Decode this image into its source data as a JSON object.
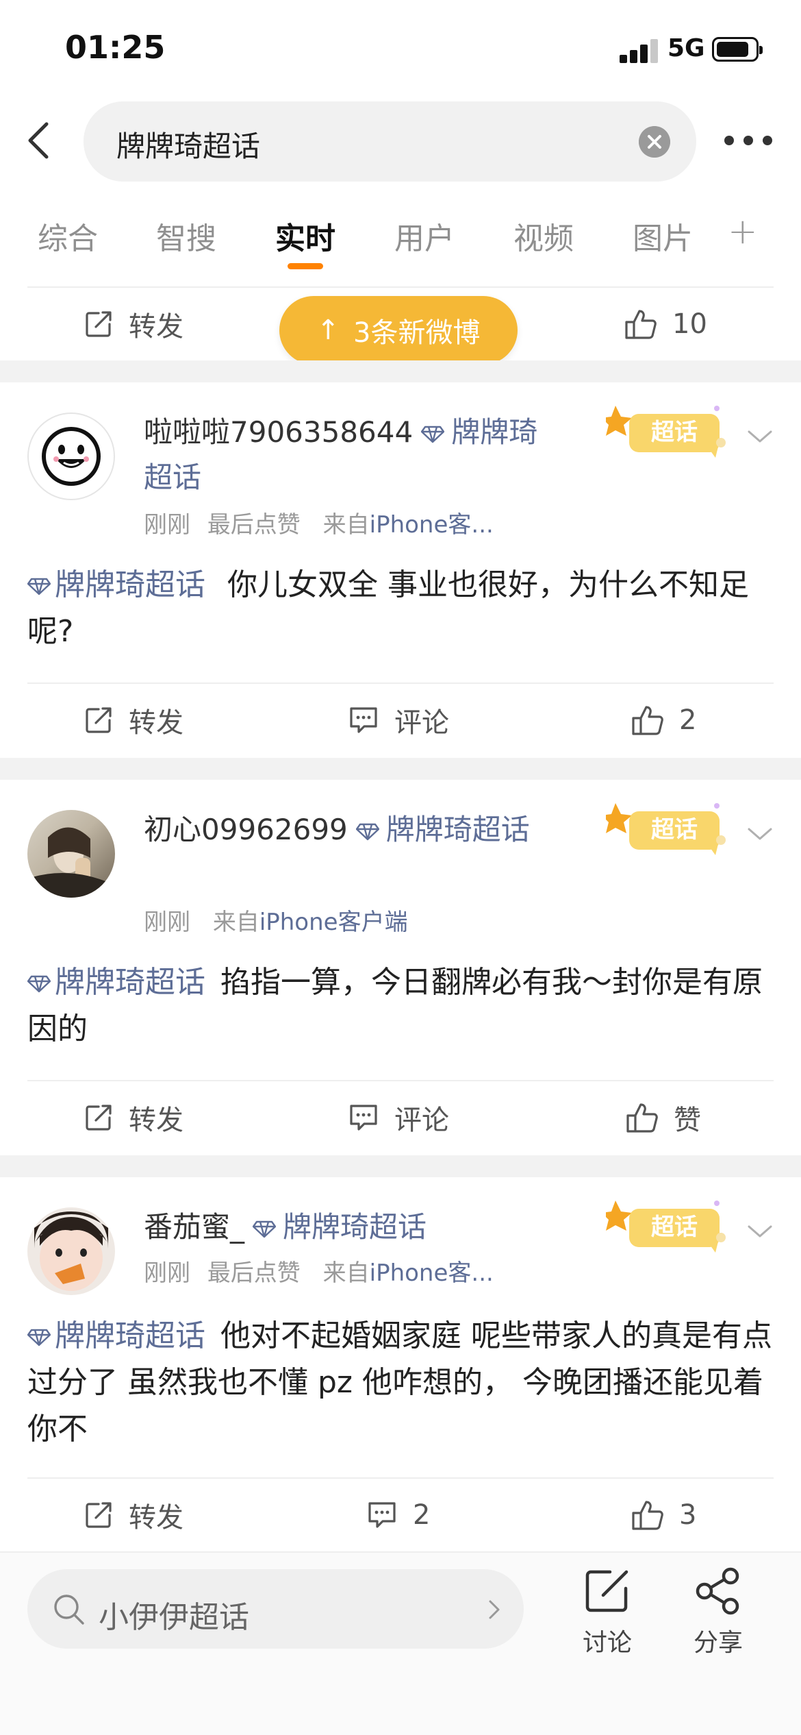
{
  "status_bar": {
    "time": "01:25",
    "network": "5G"
  },
  "search": {
    "query": "牌牌琦超话"
  },
  "tabs": [
    {
      "label": "综合"
    },
    {
      "label": "智搜"
    },
    {
      "label": "实时"
    },
    {
      "label": "用户"
    },
    {
      "label": "视频"
    },
    {
      "label": "图片"
    }
  ],
  "tabs_plus": "+",
  "top_action_bar": {
    "repost": "转发",
    "likes": "10"
  },
  "new_posts_pill": "3条新微博",
  "posts": [
    {
      "username": "啦啦啦7906358644",
      "super_topic": "牌牌琦超话",
      "time": "刚刚",
      "extra": "最后点赞",
      "source": "来自",
      "source_device": "iPhone客...",
      "badge": "超话",
      "content_tag": "牌牌琦超话",
      "content": "你儿女双全 事业也很好，为什么不知足呢?",
      "repost": "转发",
      "comment": "评论",
      "like": "2"
    },
    {
      "username": "初心09962699",
      "super_topic": "牌牌琦超话",
      "time": "刚刚",
      "source": "来自",
      "source_device": "iPhone客户端",
      "badge": "超话",
      "content_tag": "牌牌琦超话",
      "content": "掐指一算，今日翻牌必有我～封你是有原因的",
      "repost": "转发",
      "comment": "评论",
      "like": "赞"
    },
    {
      "username": "番茄蜜_",
      "super_topic": "牌牌琦超话",
      "time": "刚刚",
      "extra": "最后点赞",
      "source": "来自",
      "source_device": "iPhone客...",
      "badge": "超话",
      "content_tag": "牌牌琦超话",
      "content": "他对不起婚姻家庭 呢些带家人的真是有点过分了 虽然我也不懂 pz 他咋想的， 今晚团播还能见着你不",
      "repost": "转发",
      "comment": "2",
      "like": "3"
    }
  ],
  "bottom_bar": {
    "search_placeholder": "小伊伊超话",
    "discuss": "讨论",
    "share": "分享"
  },
  "colors": {
    "accent": "#ff8200",
    "pill": "#f5b836",
    "link": "#5d6d96",
    "badge": "#f9d66b"
  }
}
